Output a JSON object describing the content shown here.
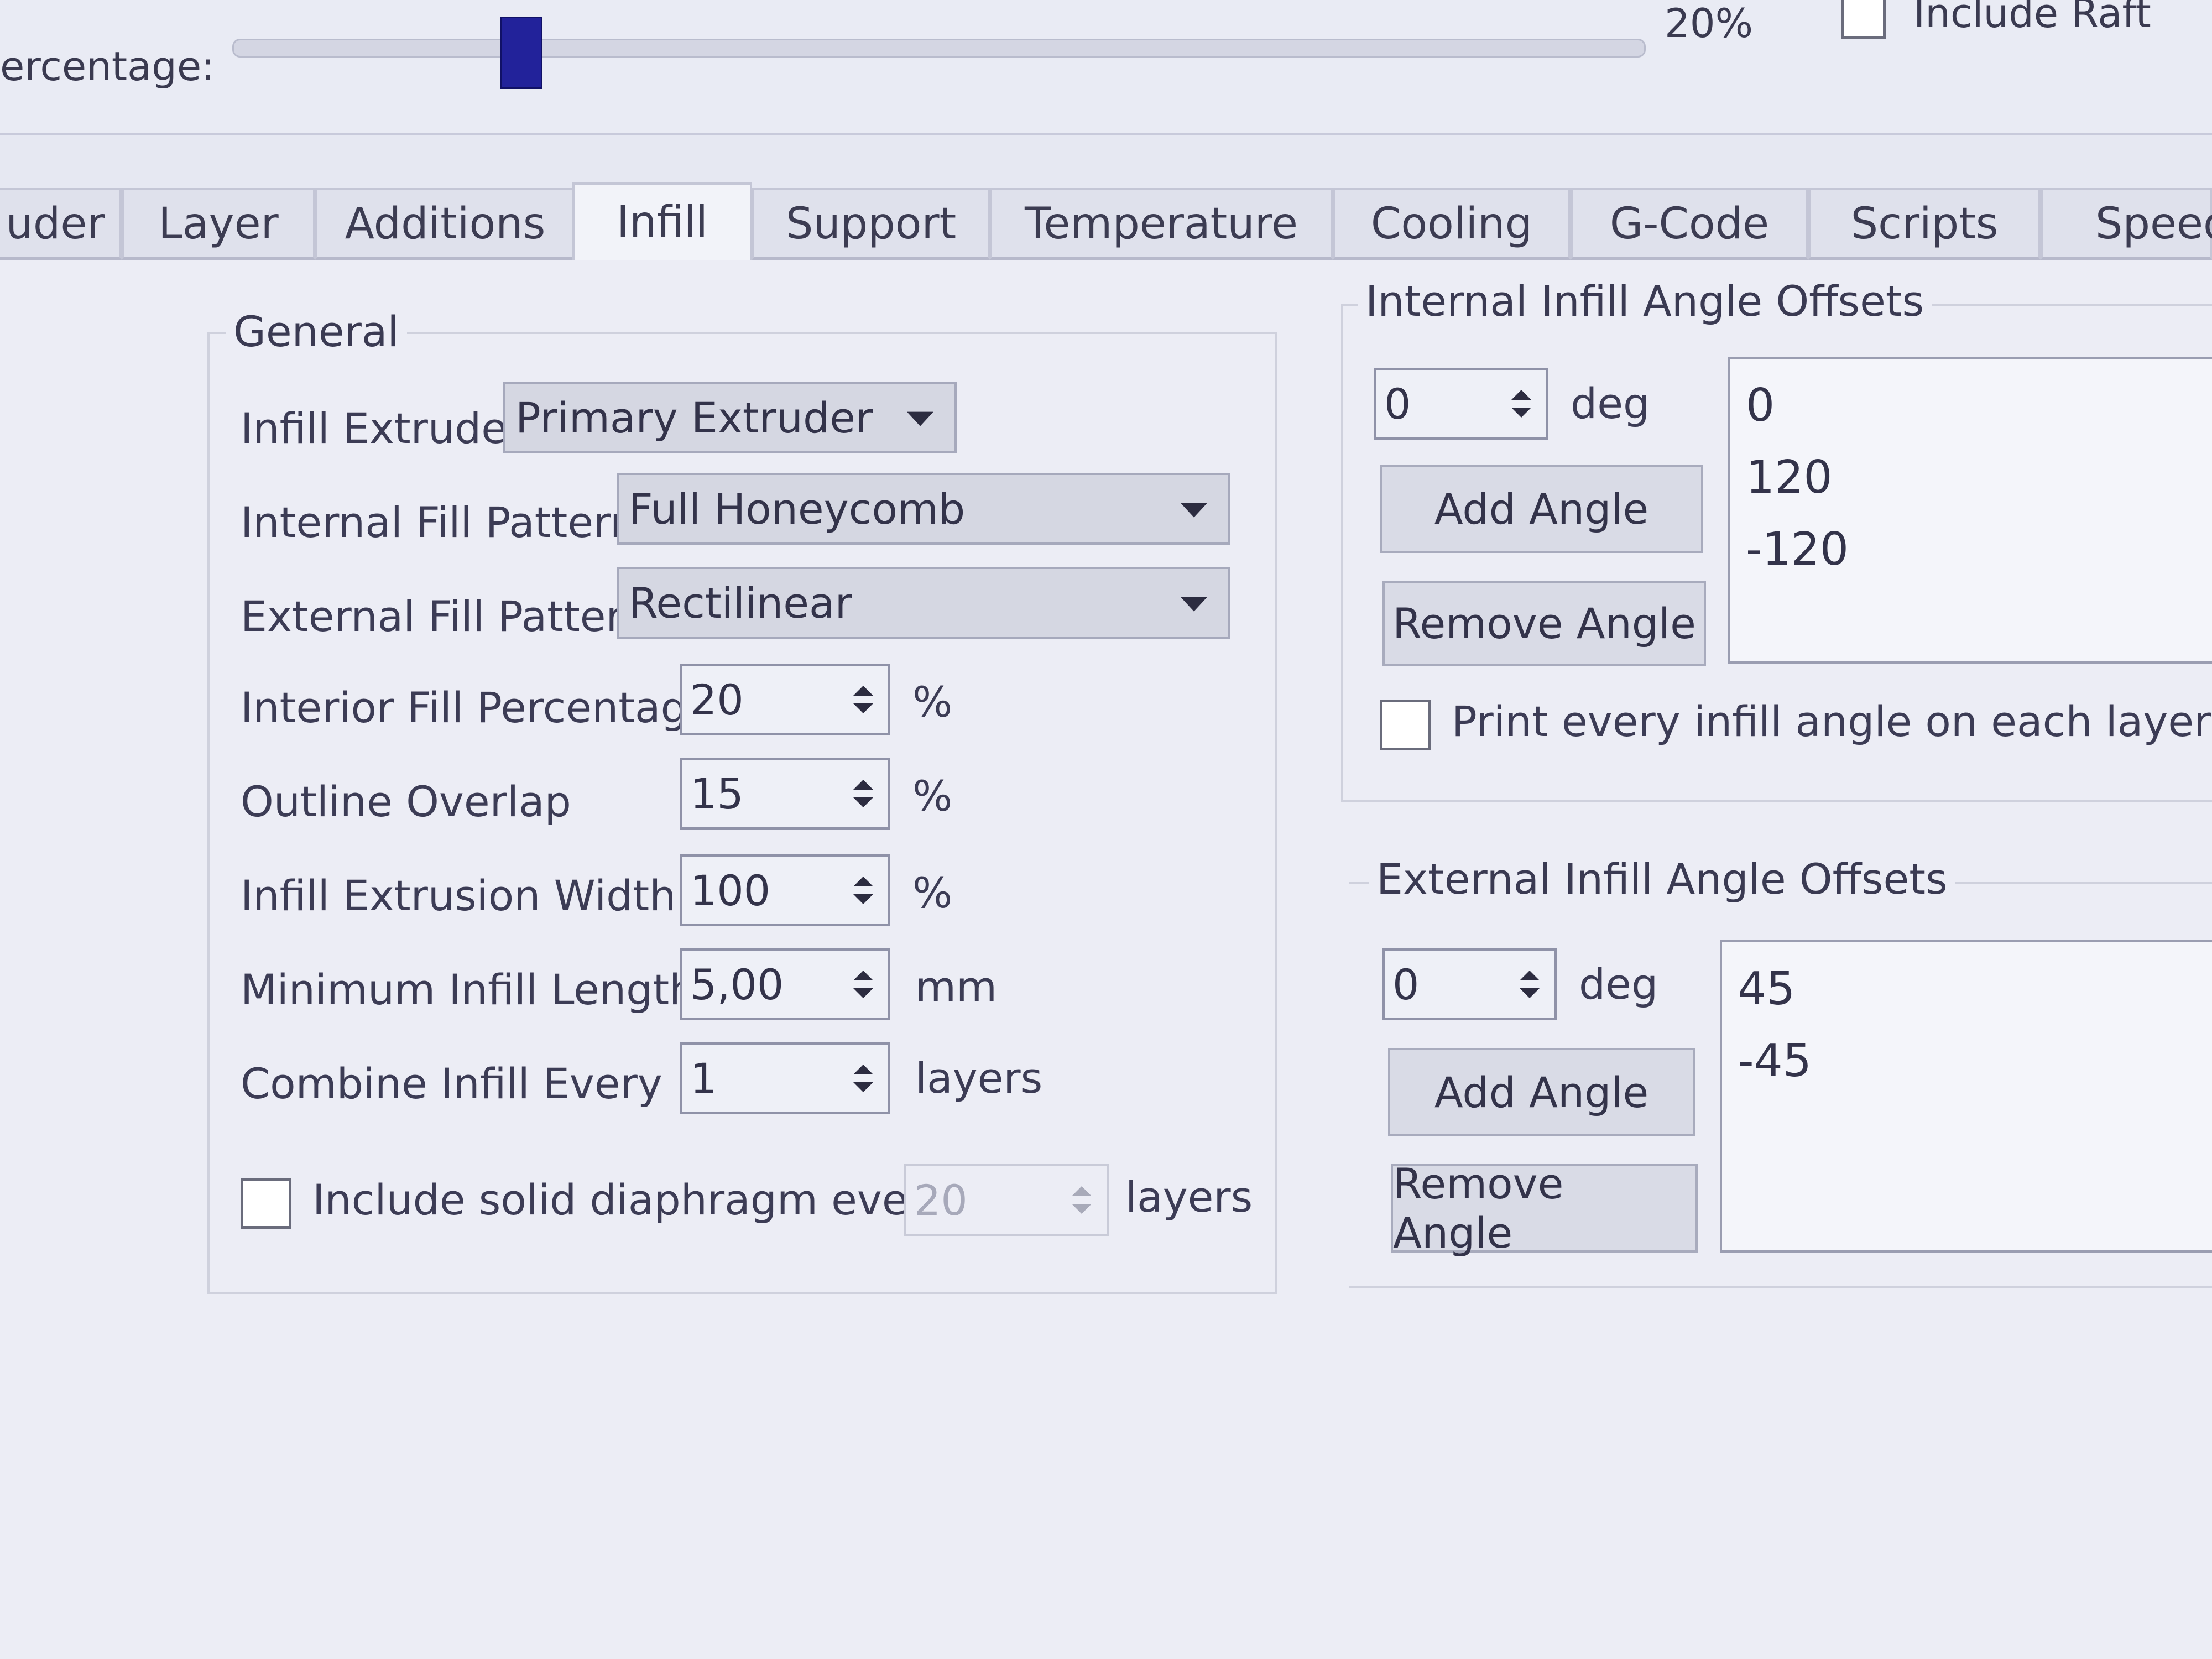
{
  "top": {
    "percentage_label": "ercentage:",
    "percentage_value": 20,
    "percentage_text": "20%",
    "include_raft_label": "Include Raft",
    "include_raft_checked": false
  },
  "tabs": [
    {
      "label": "uder"
    },
    {
      "label": "Layer"
    },
    {
      "label": "Additions"
    },
    {
      "label": "Infill",
      "active": true
    },
    {
      "label": "Support"
    },
    {
      "label": "Temperature"
    },
    {
      "label": "Cooling"
    },
    {
      "label": "G-Code"
    },
    {
      "label": "Scripts"
    },
    {
      "label": "Speed"
    }
  ],
  "general": {
    "title": "General",
    "infill_extruder": {
      "label": "Infill Extruder",
      "value": "Primary Extruder"
    },
    "internal_fill_pattern": {
      "label": "Internal Fill Pattern",
      "value": "Full Honeycomb"
    },
    "external_fill_pattern": {
      "label": "External Fill Pattern",
      "value": "Rectilinear"
    },
    "interior_fill_percentage": {
      "label": "Interior Fill Percentage",
      "value": "20",
      "unit": "%"
    },
    "outline_overlap": {
      "label": "Outline Overlap",
      "value": "15",
      "unit": "%"
    },
    "infill_extrusion_width": {
      "label": "Infill Extrusion Width",
      "value": "100",
      "unit": "%"
    },
    "minimum_infill_length": {
      "label": "Minimum Infill Length",
      "value": "5,00",
      "unit": "mm"
    },
    "combine_infill_every": {
      "label": "Combine Infill Every",
      "value": "1",
      "unit": "layers"
    },
    "solid_diaphragm": {
      "label": "Include solid diaphragm every",
      "value": "20",
      "unit": "layers",
      "checked": false
    }
  },
  "internal_angles": {
    "title": "Internal Infill Angle Offsets",
    "input_value": "0",
    "unit": "deg",
    "add_label": "Add Angle",
    "remove_label": "Remove Angle",
    "items": [
      "0",
      "120",
      "-120"
    ],
    "print_every_label": "Print every infill angle on each layer",
    "print_every_checked": false
  },
  "external_angles": {
    "title": "External Infill Angle Offsets",
    "input_value": "0",
    "unit": "deg",
    "add_label": "Add Angle",
    "remove_label": "Remove Angle",
    "items": [
      "45",
      "-45"
    ]
  }
}
